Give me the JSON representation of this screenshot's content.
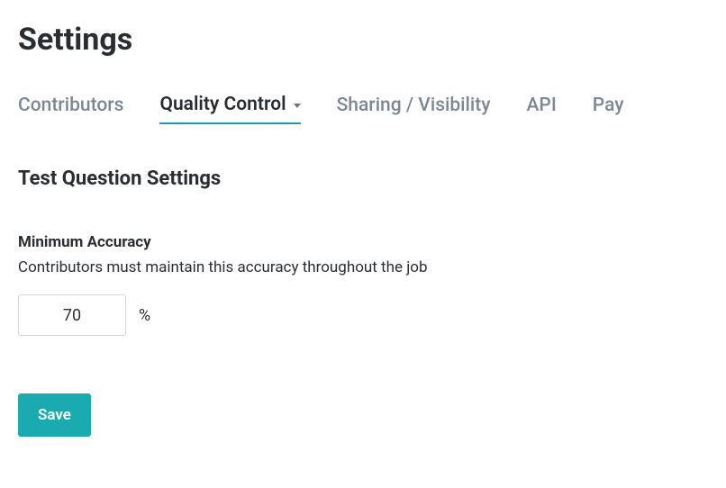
{
  "page_title": "Settings",
  "tabs": {
    "contributors": {
      "label": "Contributors",
      "active": false
    },
    "quality_control": {
      "label": "Quality Control",
      "active": true
    },
    "sharing_visibility": {
      "label": "Sharing / Visibility",
      "active": false
    },
    "api": {
      "label": "API",
      "active": false
    },
    "pay": {
      "label": "Pay",
      "active": false
    }
  },
  "section": {
    "title": "Test Question Settings",
    "min_accuracy": {
      "label": "Minimum Accuracy",
      "description": "Contributors must maintain this accuracy throughout the job",
      "value": "70",
      "unit": "%"
    }
  },
  "buttons": {
    "save": "Save"
  }
}
